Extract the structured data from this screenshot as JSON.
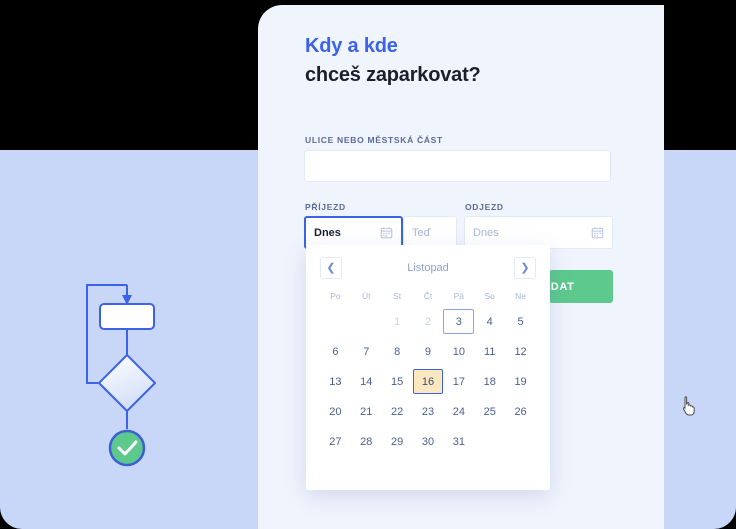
{
  "colors": {
    "brand_blue": "#3B62E8",
    "heading_dark": "#1B1F2B",
    "panel_bg": "#F0F4FD",
    "backdrop": "#C8D6F8",
    "green": "#5DC98C",
    "hover_fill": "#FCE8BE",
    "muted_text": "#A9B6D8",
    "day_text": "#4A5F92"
  },
  "heading": {
    "line1": "Kdy a kde",
    "line2": "chceš zaparkovat?"
  },
  "form": {
    "street": {
      "label": "ULICE NEBO MĚSTSKÁ ČÁST",
      "value": "",
      "placeholder": ""
    },
    "arrival": {
      "label": "PŘÍJEZD",
      "date_value": "Dnes",
      "time_placeholder": "Teď",
      "calendar_icon": "calendar-icon"
    },
    "departure": {
      "label": "ODJEZD",
      "date_placeholder": "Dnes",
      "calendar_icon": "calendar-icon"
    },
    "search_button": {
      "label": "HLEDAT",
      "visible_text": "AT"
    }
  },
  "calendar": {
    "month": "Listopad",
    "prev_icon": "chevron-left-icon",
    "next_icon": "chevron-right-icon",
    "weekdays": [
      "Po",
      "Út",
      "St",
      "Čt",
      "Pá",
      "So",
      "Ne"
    ],
    "weeks": [
      [
        {
          "label": "",
          "state": "empty"
        },
        {
          "label": "",
          "state": "empty"
        },
        {
          "label": "1",
          "state": "disabled"
        },
        {
          "label": "2",
          "state": "disabled"
        },
        {
          "label": "3",
          "state": "today"
        },
        {
          "label": "4",
          "state": "normal"
        },
        {
          "label": "5",
          "state": "normal"
        }
      ],
      [
        {
          "label": "6",
          "state": "normal"
        },
        {
          "label": "7",
          "state": "normal"
        },
        {
          "label": "8",
          "state": "normal"
        },
        {
          "label": "9",
          "state": "normal"
        },
        {
          "label": "10",
          "state": "normal"
        },
        {
          "label": "11",
          "state": "normal"
        },
        {
          "label": "12",
          "state": "normal"
        }
      ],
      [
        {
          "label": "13",
          "state": "normal"
        },
        {
          "label": "14",
          "state": "normal"
        },
        {
          "label": "15",
          "state": "normal"
        },
        {
          "label": "16",
          "state": "hover"
        },
        {
          "label": "17",
          "state": "normal"
        },
        {
          "label": "18",
          "state": "normal"
        },
        {
          "label": "19",
          "state": "normal"
        }
      ],
      [
        {
          "label": "20",
          "state": "normal"
        },
        {
          "label": "21",
          "state": "normal"
        },
        {
          "label": "22",
          "state": "normal"
        },
        {
          "label": "23",
          "state": "normal"
        },
        {
          "label": "24",
          "state": "normal"
        },
        {
          "label": "25",
          "state": "normal"
        },
        {
          "label": "26",
          "state": "normal"
        }
      ],
      [
        {
          "label": "27",
          "state": "normal"
        },
        {
          "label": "28",
          "state": "normal"
        },
        {
          "label": "29",
          "state": "normal"
        },
        {
          "label": "30",
          "state": "normal"
        },
        {
          "label": "31",
          "state": "normal"
        },
        {
          "label": "",
          "state": "empty"
        },
        {
          "label": "",
          "state": "empty"
        }
      ]
    ]
  },
  "illustration": {
    "name": "flowchart-illustration",
    "nodes": [
      "process-box",
      "decision-diamond",
      "success-check-circle"
    ],
    "check_glyph": "check-icon"
  }
}
